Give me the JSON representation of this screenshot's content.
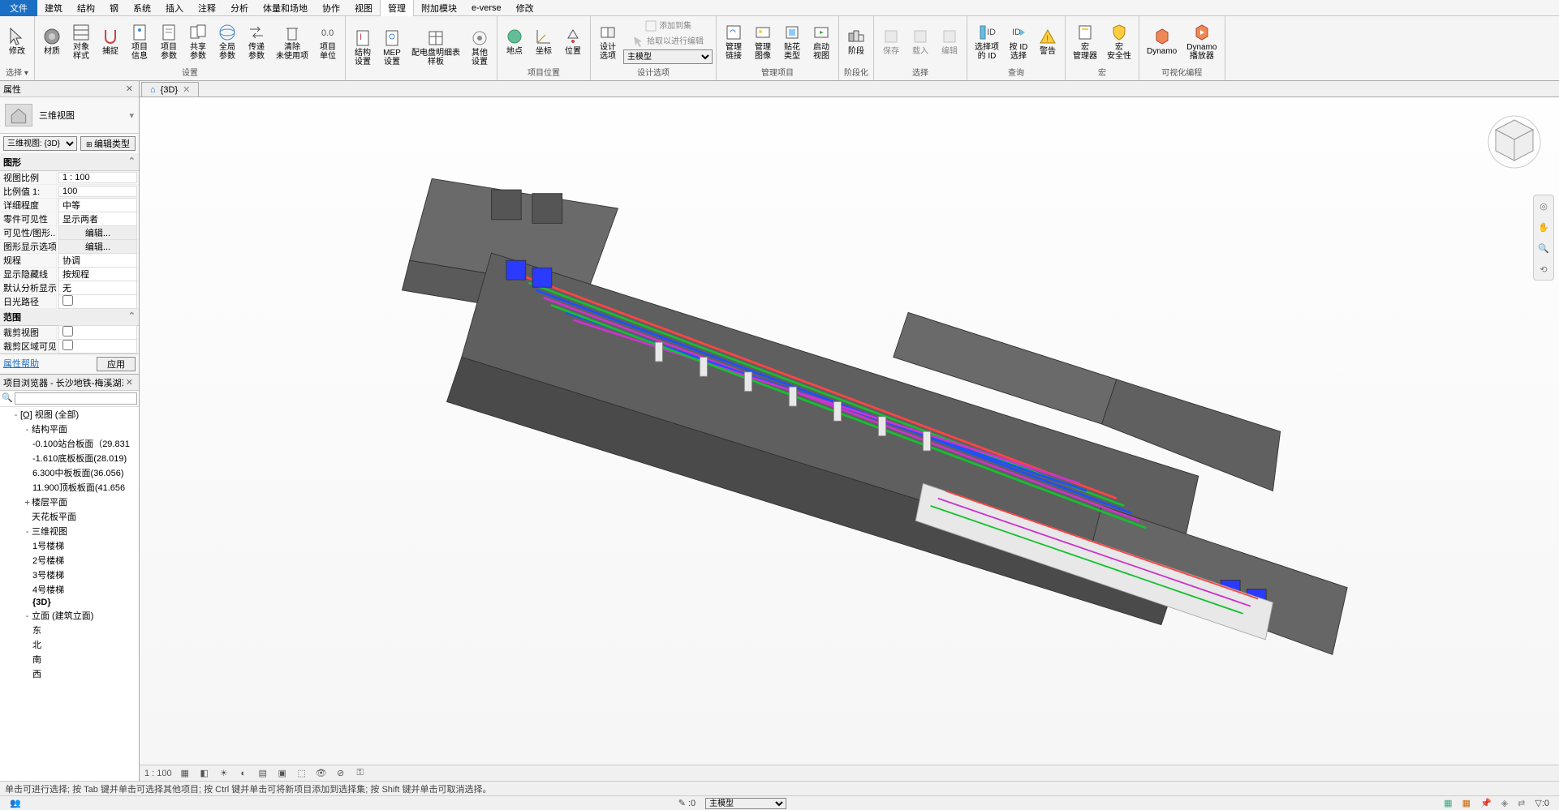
{
  "menu": {
    "file": "文件",
    "tabs": [
      "建筑",
      "结构",
      "钢",
      "系统",
      "插入",
      "注释",
      "分析",
      "体量和场地",
      "协作",
      "视图",
      "管理",
      "附加模块",
      "e-verse",
      "修改"
    ],
    "active": "管理"
  },
  "ribbon": {
    "select": {
      "modify": "修改",
      "label": "选择 ▾"
    },
    "settings": {
      "items": [
        "材质",
        "对象\n样式",
        "捕捉",
        "项目\n信息",
        "项目\n参数",
        "共享\n参数",
        "全局\n参数",
        "传递\n参数",
        "清除\n未使用项",
        "项目\n单位"
      ],
      "label": "设置"
    },
    "more_settings": {
      "items": [
        "结构\n设置",
        "MEP\n设置",
        "配电盘明细表\n样板",
        "其他\n设置"
      ],
      "label": ""
    },
    "location": {
      "items": [
        "地点",
        "坐标",
        "位置"
      ],
      "label": "项目位置"
    },
    "design_opts": {
      "items": [
        "设计\n选项"
      ],
      "small": [
        "添加到集",
        "拾取以进行编辑"
      ],
      "dd": "主模型",
      "label": "设计选项"
    },
    "manage_proj": {
      "items": [
        "管理\n链接",
        "管理\n图像",
        "贴花\n类型",
        "启动\n视图"
      ],
      "label": "管理项目"
    },
    "phasing": {
      "items": [
        "阶段"
      ],
      "label": "阶段化"
    },
    "selection": {
      "items": [
        "保存",
        "载入",
        "编辑"
      ],
      "label": "选择"
    },
    "inquiry": {
      "items": [
        "选择项\n的 ID",
        "按 ID\n选择",
        "警告"
      ],
      "label": "查询"
    },
    "macros": {
      "items": [
        "宏\n管理器",
        "宏\n安全性"
      ],
      "label": "宏"
    },
    "dynamo": {
      "items": [
        "Dynamo",
        "Dynamo\n播放器"
      ],
      "label": "可视化编程"
    }
  },
  "props": {
    "title": "属性",
    "type_name": "三维视图",
    "instance_dd": "三维视图: {3D}",
    "edit_type": "编辑类型",
    "g_graphics": "图形",
    "rows": [
      {
        "k": "视图比例",
        "v": "1 : 100"
      },
      {
        "k": "比例值 1:",
        "v": "100"
      },
      {
        "k": "详细程度",
        "v": "中等"
      },
      {
        "k": "零件可见性",
        "v": "显示两者"
      },
      {
        "k": "可见性/图形...",
        "v": "编辑...",
        "btn": true
      },
      {
        "k": "图形显示选项",
        "v": "编辑...",
        "btn": true
      },
      {
        "k": "规程",
        "v": "协调"
      },
      {
        "k": "显示隐藏线",
        "v": "按规程"
      },
      {
        "k": "默认分析显示...",
        "v": "无"
      },
      {
        "k": "日光路径",
        "v": "",
        "chk": true
      }
    ],
    "g_extents": "范围",
    "rows2": [
      {
        "k": "裁剪视图",
        "v": "",
        "chk": true
      },
      {
        "k": "裁剪区域可见",
        "v": "",
        "chk": true
      }
    ],
    "help": "属性帮助",
    "apply": "应用"
  },
  "browser": {
    "title": "项目浏览器 - 长沙地铁-梅溪湖东站 ...",
    "search_ph": "",
    "root": "视图 (全部)",
    "nodes": [
      {
        "t": "结构平面",
        "exp": "-",
        "lvl": 2,
        "children": [
          "-0.100站台板面（29.831",
          "-1.610底板板面(28.019)",
          "6.300中板板面(36.056)",
          "11.900顶板板面(41.656"
        ]
      },
      {
        "t": "楼层平面",
        "exp": "+",
        "lvl": 2
      },
      {
        "t": "天花板平面",
        "exp": "",
        "lvl": 2
      },
      {
        "t": "三维视图",
        "exp": "-",
        "lvl": 2,
        "children": [
          "1号楼梯",
          "2号楼梯",
          "3号楼梯",
          "4号楼梯",
          "{3D}"
        ],
        "sel": "{3D}"
      },
      {
        "t": "立面 (建筑立面)",
        "exp": "-",
        "lvl": 2,
        "children": [
          "东",
          "北",
          "南",
          "西"
        ]
      }
    ]
  },
  "view": {
    "tab": "{3D}",
    "scale": "1 : 100"
  },
  "status": {
    "hint": "单击可进行选择; 按 Tab 键并单击可选择其他项目; 按 Ctrl 键并单击可将新项目添加到选择集; 按 Shift 键并单击可取消选择。",
    "model": "主模型",
    "zero": ":0",
    "filter": "▽:0"
  }
}
